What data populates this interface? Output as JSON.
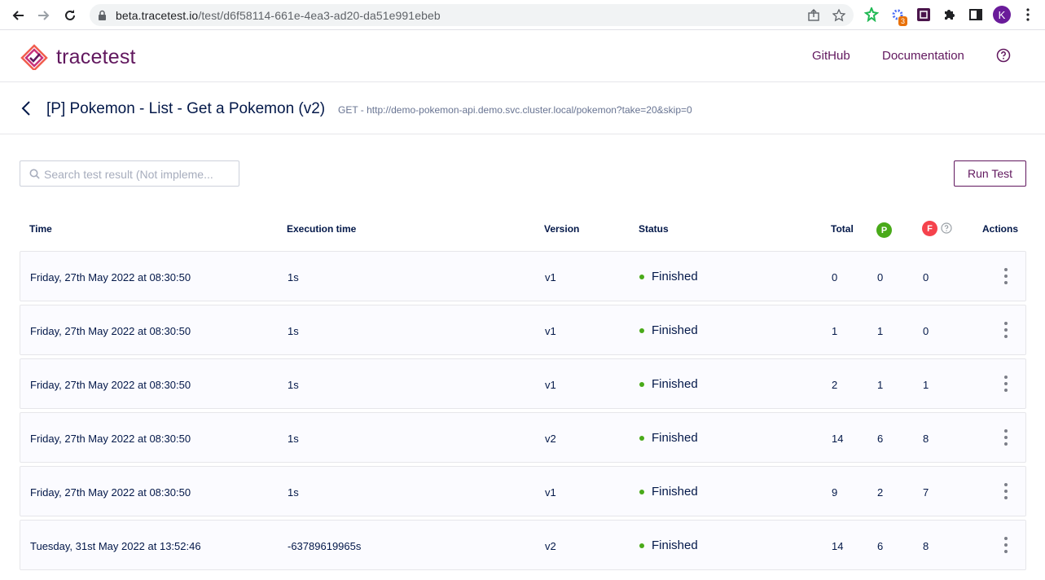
{
  "browser": {
    "url_host": "beta.tracetest.io",
    "url_path": "/test/d6f58114-661e-4ea3-ad20-da51e991ebeb",
    "extension_badge": "3",
    "profile_initial": "K"
  },
  "header": {
    "brand": "tracetest",
    "links": [
      {
        "label": "GitHub"
      },
      {
        "label": "Documentation"
      }
    ]
  },
  "test": {
    "title": "[P] Pokemon - List - Get a Pokemon (v2)",
    "meta": "GET - http://demo-pokemon-api.demo.svc.cluster.local/pokemon?take=20&skip=0"
  },
  "toolbar": {
    "search_placeholder": "Search test result (Not impleme...",
    "run_label": "Run Test"
  },
  "table": {
    "columns": {
      "time": "Time",
      "execution": "Execution time",
      "version": "Version",
      "status": "Status",
      "total": "Total",
      "passed_badge": "P",
      "failed_badge": "F",
      "actions": "Actions"
    },
    "rows": [
      {
        "time": "Friday, 27th May 2022 at 08:30:50",
        "execution": "1s",
        "version": "v1",
        "status": "Finished",
        "total": "0",
        "passed": "0",
        "failed": "0"
      },
      {
        "time": "Friday, 27th May 2022 at 08:30:50",
        "execution": "1s",
        "version": "v1",
        "status": "Finished",
        "total": "1",
        "passed": "1",
        "failed": "0"
      },
      {
        "time": "Friday, 27th May 2022 at 08:30:50",
        "execution": "1s",
        "version": "v1",
        "status": "Finished",
        "total": "2",
        "passed": "1",
        "failed": "1"
      },
      {
        "time": "Friday, 27th May 2022 at 08:30:50",
        "execution": "1s",
        "version": "v2",
        "status": "Finished",
        "total": "14",
        "passed": "6",
        "failed": "8"
      },
      {
        "time": "Friday, 27th May 2022 at 08:30:50",
        "execution": "1s",
        "version": "v1",
        "status": "Finished",
        "total": "9",
        "passed": "2",
        "failed": "7"
      },
      {
        "time": "Tuesday, 31st May 2022 at 13:52:46",
        "execution": "-63789619965s",
        "version": "v2",
        "status": "Finished",
        "total": "14",
        "passed": "6",
        "failed": "8"
      }
    ]
  },
  "colors": {
    "brand": "#61175e",
    "passed": "#49aa19",
    "failed": "#f5424c",
    "text": "#031849"
  }
}
